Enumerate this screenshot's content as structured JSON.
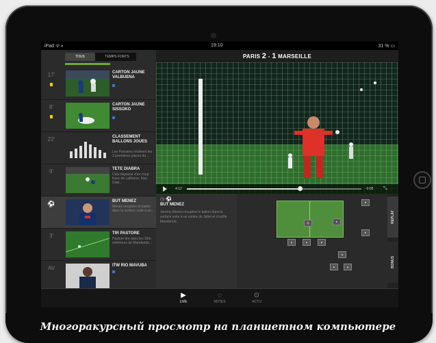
{
  "status": {
    "left": "iPad ᯤ ◐",
    "time": "19:10",
    "right": "31 % ▭"
  },
  "tabs": {
    "all": "TOUS",
    "highlights": "TEMPS FORTS"
  },
  "match": {
    "home": "PARIS",
    "home_score": "2",
    "sep": "-",
    "away_score": "1",
    "away": "MARSEILLE"
  },
  "events": [
    {
      "minute": "17'",
      "title": "CARTON JAUNE VALBUENA",
      "text": "",
      "card": true
    },
    {
      "minute": "8'",
      "title": "CARTON JAUNE SISSOKO",
      "text": "",
      "card": true
    },
    {
      "minute": "22'",
      "title": "CLASSEMENT BALLONS JOUES",
      "text": "Les Parisiens réalisent les 3 premières places du...",
      "card": false
    },
    {
      "minute": "9'",
      "title": "TETE DIABRA",
      "text": "Cela dépasse d'un coup franc de Lafforine, Max Diab...",
      "card": false
    },
    {
      "minute": "",
      "title": "BUT MENEZ",
      "text": "Menez récupère le ballon dans la surface suite à un...",
      "card": false
    },
    {
      "minute": "3'",
      "title": "TIR PASTORE",
      "text": "Pastore tire dans les 16m extérieurs de Mandanda...",
      "card": false
    },
    {
      "minute": "AV",
      "title": "ITW RIO MAVUBA",
      "text": "",
      "card": false
    }
  ],
  "player": {
    "time_left": "4:12",
    "time_right": "-0:08",
    "progress": 0.65
  },
  "detail": {
    "icons": "◷ ⚽",
    "title": "BUT MENEZ",
    "body": "Jeremy Menez récupère le ballon dans la surface suite à un contre de Jallet et crucifie Mandanda."
  },
  "side_tabs": {
    "replay": "REPLAY",
    "bonus": "BONUS"
  },
  "nav": [
    {
      "icon": "▶",
      "label": "LIVE"
    },
    {
      "icon": "◌",
      "label": "NOTES"
    },
    {
      "icon": "⊙",
      "label": "ACTU"
    }
  ],
  "caption": "Многоракурсный просмотр на планшетном компьютере",
  "colors": {
    "accent_green": "#6fa83b",
    "yellow_card": "#e8d400",
    "link_blue": "#3b78c4"
  }
}
